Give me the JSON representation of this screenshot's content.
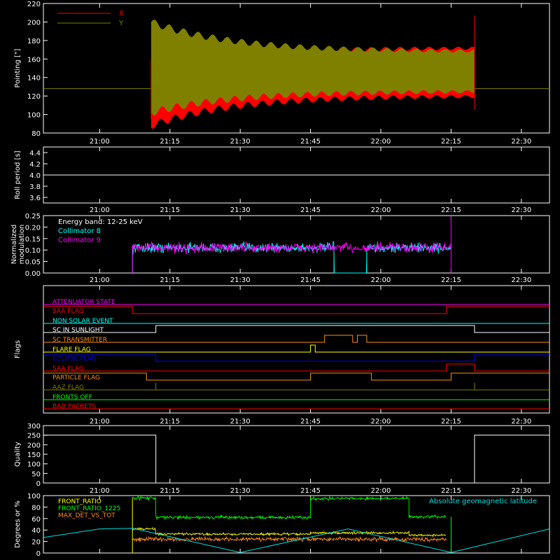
{
  "colors": {
    "background": "#000000",
    "axes": "#ffffff",
    "x_pointing": "#ff0000",
    "y_pointing": "#808000",
    "collimator8": "#00ffff",
    "collimator9": "#ff00ff",
    "front_ratio": "#ffff00",
    "front_ratio_1225": "#00ff00",
    "max_det_vs_tot": "#ff8c1a",
    "geomagnetic": "#00e0e0"
  },
  "time_ticks": [
    "21:00",
    "21:15",
    "21:30",
    "21:45",
    "22:00",
    "22:15",
    "22:30"
  ],
  "chart_data": [
    {
      "id": "pointing",
      "type": "area",
      "ylabel": "Pointing [\"]",
      "ylim": [
        80,
        220
      ],
      "yticks": [
        "80",
        "100",
        "120",
        "140",
        "160",
        "180",
        "200",
        "220"
      ],
      "legend": [
        "X",
        "Y"
      ],
      "legend_position": "top-left",
      "series": [
        {
          "name": "X",
          "baseline": 128,
          "data_span": [
            "21:11",
            "22:20"
          ],
          "upper_start": 150,
          "upper_end": 172,
          "lower_start": 88,
          "lower_end": 120
        },
        {
          "name": "Y",
          "baseline": 128,
          "data_span": [
            "21:11",
            "22:20"
          ],
          "upper_start": 200,
          "upper_end": 168,
          "lower_start": 102,
          "lower_end": 125
        }
      ]
    },
    {
      "id": "roll_period",
      "type": "line",
      "ylabel": "Roll period [s]",
      "ylim": [
        3.5,
        4.5
      ],
      "yticks": [
        "3.6",
        "3.8",
        "4.0",
        "4.2",
        "4.4"
      ],
      "series": [
        {
          "value": 4.0
        }
      ]
    },
    {
      "id": "modulation",
      "type": "line",
      "ylabel_lines": [
        "Normalized",
        "modulation"
      ],
      "ylim": [
        0,
        0.25
      ],
      "yticks": [
        "0.00",
        "0.05",
        "0.10",
        "0.15",
        "0.20",
        "0.25"
      ],
      "annotation": "Energy band: 12-25 keV",
      "legend": [
        "Collimator 8",
        "Collimator 9"
      ],
      "data_span": [
        "21:07",
        "22:15"
      ],
      "series": [
        {
          "name": "Collimator 8",
          "mean": 0.11,
          "spread": 0.02,
          "gaps": [
            [
              "21:50",
              "21:57"
            ]
          ]
        },
        {
          "name": "Collimator 9",
          "mean": 0.11,
          "spread": 0.02
        }
      ]
    },
    {
      "id": "flags",
      "type": "line",
      "ylabel": "Flags",
      "series": [
        {
          "name": "ATTENUATOR STATE",
          "color": "#ff00ff",
          "transitions": []
        },
        {
          "name": "SAA FLAG",
          "color": "#ff0000",
          "initial": 1,
          "transitions": [
            "21:07",
            "22:14"
          ]
        },
        {
          "name": "NON SOLAR EVENT",
          "color": "#00ffff",
          "transitions": []
        },
        {
          "name": "SC IN SUNLIGHT",
          "color": "#ffffff",
          "initial": 0,
          "transitions": [
            "21:12",
            "22:20"
          ]
        },
        {
          "name": "SC TRANSMITTER",
          "color": "#ff8c1a",
          "initial": 0,
          "transitions": [
            "21:48",
            "21:54",
            "21:55",
            "21:57"
          ]
        },
        {
          "name": "FLARE FLAG",
          "color": "#ffff00",
          "initial": 0,
          "transitions": [
            "21:45",
            "21:46"
          ]
        },
        {
          "name": "ECLIPSE FLAG",
          "color": "#0000ff",
          "initial": 1,
          "transitions": [
            "21:12",
            "22:20"
          ]
        },
        {
          "name": "SAA FLAG",
          "color": "#ff0000",
          "initial": 0,
          "transitions": [
            "22:14",
            "22:20"
          ]
        },
        {
          "name": "PARTICLE FLAG",
          "color": "#ff8c1a",
          "initial": 1,
          "transitions": [
            "21:10",
            "21:45",
            "21:58",
            "22:15"
          ]
        },
        {
          "name": "AAZ FLAG",
          "color": "#808000",
          "initial": 0,
          "transitions": [
            "21:12",
            "21:12",
            "22:20",
            "22:20"
          ]
        },
        {
          "name": "FRONTS OFF",
          "color": "#00ff00",
          "transitions": []
        },
        {
          "name": "BAD PACKETS",
          "color": "#ff0000",
          "transitions": []
        }
      ]
    },
    {
      "id": "quality",
      "type": "line",
      "ylabel": "Quality",
      "ylim": [
        0,
        300
      ],
      "yticks": [
        "0",
        "50",
        "100",
        "150",
        "200",
        "250",
        "300"
      ],
      "series": [
        {
          "high_value": 250,
          "low_value": 0,
          "transitions": [
            "21:12",
            "22:20"
          ]
        }
      ]
    },
    {
      "id": "ratios",
      "type": "line",
      "ylabel": "Degrees or %",
      "ylim": [
        0,
        100
      ],
      "yticks": [
        "0",
        "20",
        "40",
        "60",
        "80",
        "100"
      ],
      "legend": [
        "FRONT_RATIO",
        "FRONT_RATIO_1225",
        "MAX_DET_VS_TOT"
      ],
      "annotation": "Absolute geomagnetic latitude",
      "data_span": [
        "21:07",
        "22:15"
      ],
      "series": [
        {
          "name": "FRONT_RATIO",
          "segments": [
            {
              "from": "21:07",
              "to": "21:12",
              "value": 42
            },
            {
              "from": "21:12",
              "to": "21:45",
              "value": 33
            },
            {
              "from": "21:45",
              "to": "22:06",
              "value": 35
            },
            {
              "from": "22:06",
              "to": "22:14",
              "value": 31
            }
          ]
        },
        {
          "name": "FRONT_RATIO_1225",
          "segments": [
            {
              "from": "21:07",
              "to": "21:12",
              "value": 96
            },
            {
              "from": "21:12",
              "to": "21:45",
              "value": 62
            },
            {
              "from": "21:45",
              "to": "22:06",
              "value": 95
            },
            {
              "from": "22:06",
              "to": "22:14",
              "value": 63
            }
          ]
        },
        {
          "name": "MAX_DET_VS_TOT",
          "segments": [
            {
              "from": "21:07",
              "to": "22:14",
              "value": 24
            }
          ]
        },
        {
          "name": "Absolute geomagnetic latitude",
          "points": [
            [
              "20:48",
              27
            ],
            [
              "21:00",
              42
            ],
            [
              "21:07",
              43
            ],
            [
              "21:30",
              1
            ],
            [
              "21:53",
              42
            ],
            [
              "22:15",
              1
            ],
            [
              "22:36",
              42
            ]
          ]
        }
      ]
    }
  ]
}
